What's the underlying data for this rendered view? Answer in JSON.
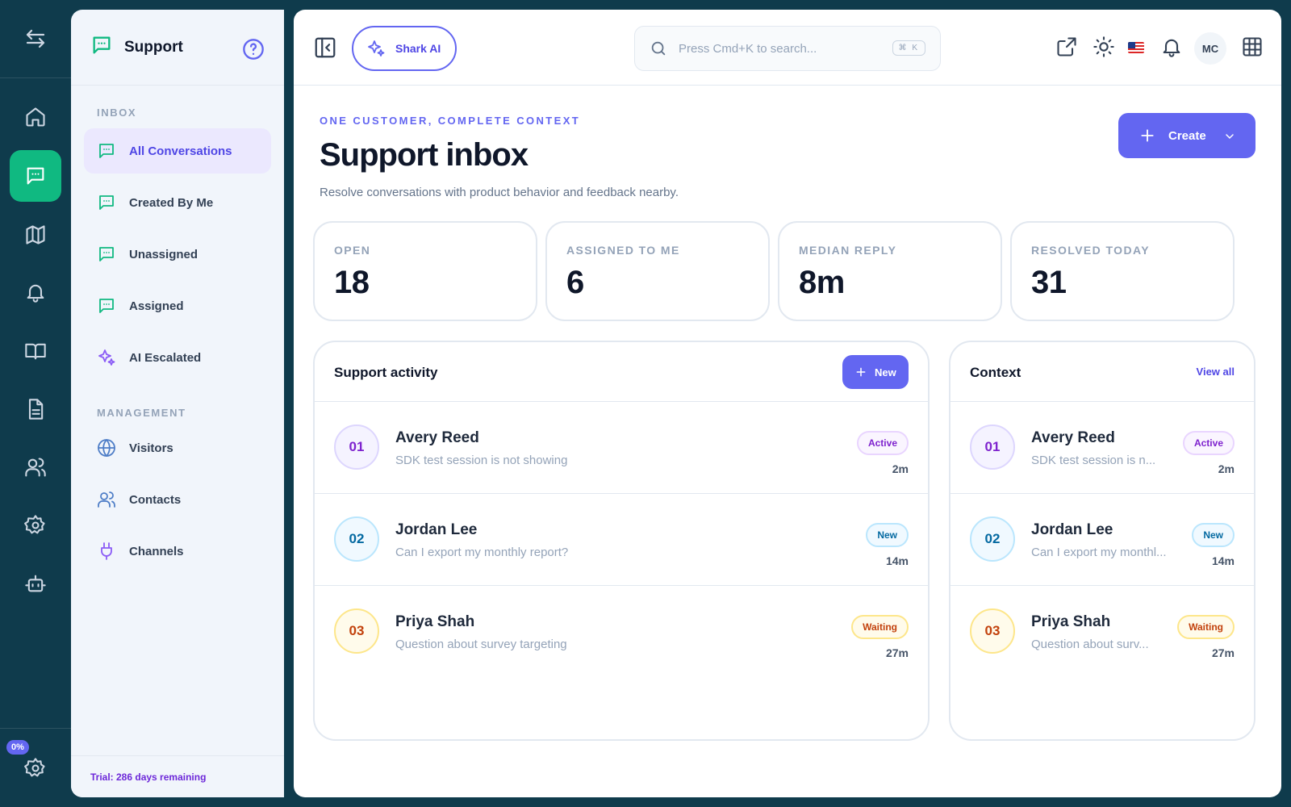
{
  "sidebar": {
    "title": "Support",
    "inbox_section": "INBOX",
    "inbox_items": [
      "All Conversations",
      "Created By Me",
      "Unassigned",
      "Assigned",
      "AI Escalated"
    ],
    "management_section": "MANAGEMENT",
    "management_items": [
      "Visitors",
      "Contacts",
      "Channels"
    ],
    "trial": "Trial: 286 days remaining"
  },
  "rail": {
    "items": [
      "home-icon",
      "chat-icon",
      "map-icon",
      "bell-icon",
      "book-icon",
      "document-icon",
      "users-icon",
      "gear-icon",
      "bot-icon"
    ],
    "active_item": "chat-icon",
    "progress_badge": "0%"
  },
  "topbar": {
    "ai_button": "Shark AI",
    "search_placeholder": "Press Cmd+K to search...",
    "search_shortcut": "⌘ K",
    "avatar_initials": "MC"
  },
  "page": {
    "eyebrow": "ONE CUSTOMER, COMPLETE CONTEXT",
    "title": "Support inbox",
    "subtitle": "Resolve conversations with product behavior and feedback nearby.",
    "create_button": "Create"
  },
  "stats": [
    {
      "label": "OPEN",
      "value": "18"
    },
    {
      "label": "ASSIGNED TO ME",
      "value": "6"
    },
    {
      "label": "MEDIAN REPLY",
      "value": "8m"
    },
    {
      "label": "RESOLVED TODAY",
      "value": "31"
    }
  ],
  "activity": {
    "title": "Support activity",
    "new_button": "New",
    "rows": [
      {
        "num": "01",
        "name": "Avery Reed",
        "message": "SDK test session is not showing",
        "status": "Active",
        "time": "2m"
      },
      {
        "num": "02",
        "name": "Jordan Lee",
        "message": "Can I export my monthly report?",
        "status": "New",
        "time": "14m"
      },
      {
        "num": "03",
        "name": "Priya Shah",
        "message": "Question about survey targeting",
        "status": "Waiting",
        "time": "27m"
      }
    ]
  },
  "context": {
    "title": "Context",
    "view_all": "View all",
    "rows": [
      {
        "num": "01",
        "name": "Avery Reed",
        "message": "SDK test session is n...",
        "status": "Active",
        "time": "2m"
      },
      {
        "num": "02",
        "name": "Jordan Lee",
        "message": "Can I export my monthl...",
        "status": "New",
        "time": "14m"
      },
      {
        "num": "03",
        "name": "Priya Shah",
        "message": "Question about surv...",
        "status": "Waiting",
        "time": "27m"
      }
    ]
  },
  "colors": {
    "accent": "#6366f1",
    "rail_bg": "#0f3b4c",
    "active_green": "#10b981"
  }
}
